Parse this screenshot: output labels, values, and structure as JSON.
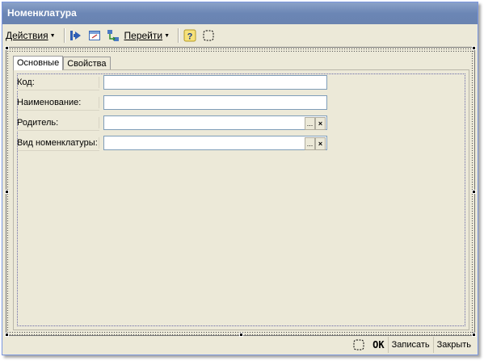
{
  "window": {
    "title": "Номенклатура"
  },
  "toolbar": {
    "actions_label": "Действия",
    "goto_label": "Перейти"
  },
  "tabs": [
    {
      "label": "Основные",
      "active": true
    },
    {
      "label": "Свойства",
      "active": false
    }
  ],
  "fields": [
    {
      "label": "Код:",
      "value": ""
    },
    {
      "label": "Наименование:",
      "value": ""
    },
    {
      "label": "Родитель:",
      "value": "",
      "choose_label": "...",
      "clear_label": "×"
    },
    {
      "label": "Вид номенклатуры:",
      "value": "",
      "choose_label": "...",
      "clear_label": "×"
    }
  ],
  "bottom": {
    "ok_label": "OK",
    "save_label": "Записать",
    "close_label": "Закрыть"
  },
  "colors": {
    "title_bar": "#6b86b5",
    "window_bg": "#ece9d8",
    "field_border": "#7f9db9"
  }
}
